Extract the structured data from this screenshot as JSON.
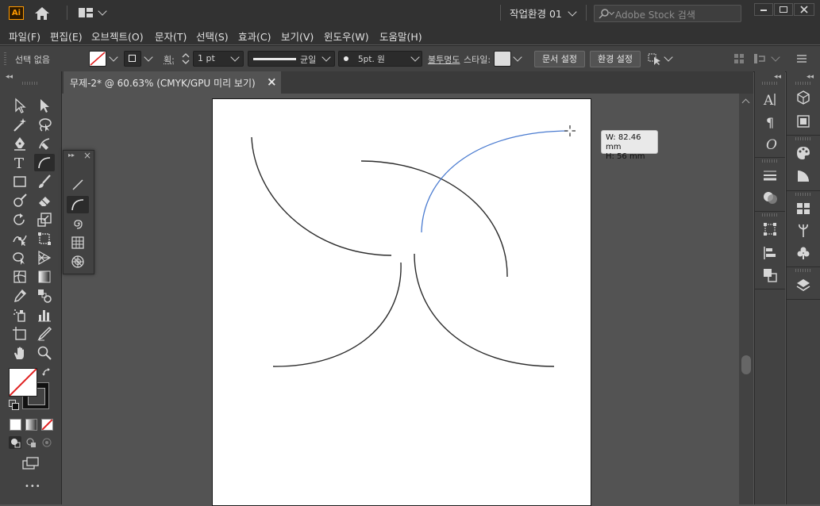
{
  "app": {
    "logo_text": "Ai",
    "workspace_label": "작업환경 01",
    "search_placeholder": "Adobe Stock 검색"
  },
  "menu": [
    "파일(F)",
    "편집(E)",
    "오브젝트(O)",
    "문자(T)",
    "선택(S)",
    "효과(C)",
    "보기(V)",
    "윈도우(W)",
    "도움말(H)"
  ],
  "control": {
    "selection_status": "선택 없음",
    "stroke_label": "획:",
    "stroke_weight": "1 pt",
    "stroke_profile": "균일",
    "brush_label": "5pt. 원",
    "opacity_label": "불투명도",
    "style_label": "스타일:",
    "doc_setup_button": "문서 설정",
    "prefs_button": "환경 설정"
  },
  "document": {
    "tab_title": "무제-2* @ 60.63% (CMYK/GPU 미리 보기)",
    "close_glyph": "×"
  },
  "tooltip": {
    "width": "W: 82.46 mm",
    "height": "H: 56 mm"
  },
  "colors": {
    "ui_dark": "#323232",
    "ui_panel": "#424242",
    "canvas_bg": "#535353",
    "selection_blue": "#4a7bd0",
    "stroke_color": "#2b2b2b",
    "logo_orange": "#ff9a00"
  },
  "toolbar_more_glyph": "•••"
}
